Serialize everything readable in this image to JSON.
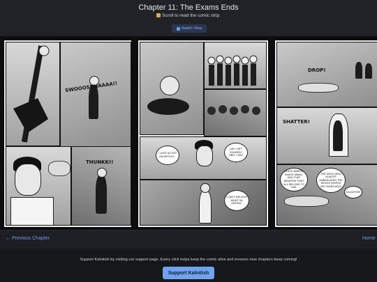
{
  "header": {
    "title": "Chapter 11: The Exams Ends",
    "subtitle": "Scroll to read the comic strip.",
    "switch_view_label": "Switch View"
  },
  "comic": {
    "page1": {
      "sfx_1": "SWOOOSHHAAAA!!",
      "sfx_2": "THUNKK!!"
    },
    "page2": {
      "bubble_1": "I JUST ACTED ON REFLEX...",
      "bubble_2": "DID I GET SCARED? HEH, I DID!",
      "bubble_3": "I CAN'T BELIEVE WHAT I'M SEEING."
    },
    "page3": {
      "sfx_drop": "DROP!",
      "sfx_shatter": "SHATTER!",
      "bubble_1": "BLACK WINGS, BLACK MANA, AND THAT WEAPON! THEY ALL BELONG TO HIM.",
      "bubble_2": "THE DEVIL WHO ALMOST ANNIHILATED THE WHOLE WORLD 300 YEARS AGO!",
      "bubble_3": "KALNITISH!"
    }
  },
  "nav": {
    "previous_label": "← Previous Chapter",
    "home_label": "Home"
  },
  "support": {
    "message": "Support Kalnitish by visiting our support page. Every click helps keep the comic alive and ensures new chapters keep coming!",
    "button_label": "Support Kalnitish"
  },
  "colors": {
    "accent": "#6fa3f0",
    "link": "#6f9be6",
    "background": "#16171b"
  }
}
